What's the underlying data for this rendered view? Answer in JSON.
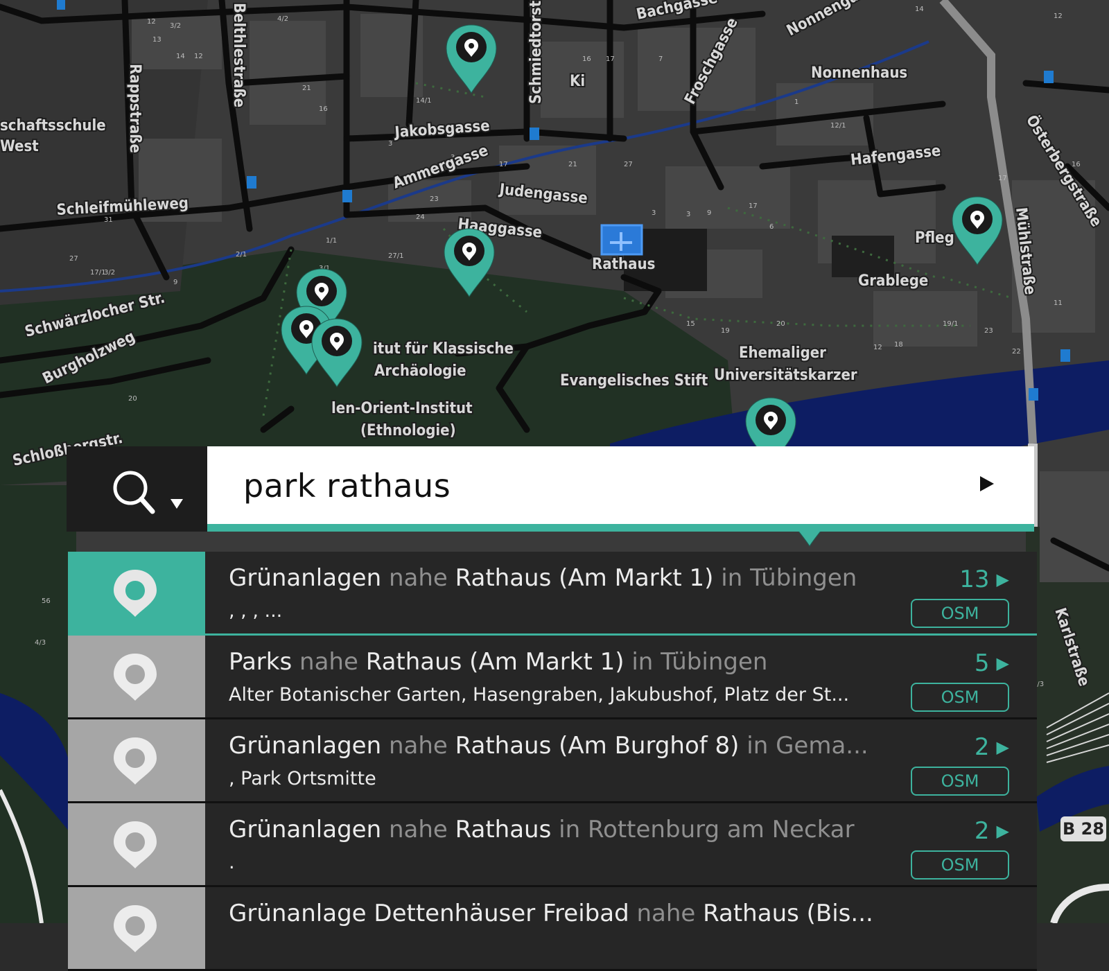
{
  "map": {
    "streets": [
      "Bachgasse",
      "Nonnengasse",
      "Nonnenhaus",
      "Froschgasse",
      "Schmiedtorstr.",
      "Belthlestraße",
      "Rappstraße",
      "Jakobsgasse",
      "Ammergasse",
      "Judengasse",
      "Haaggasse",
      "Hafengasse",
      "Österbergstraße",
      "Mühlstraße",
      "Schleifmühleweg",
      "Schwärzlocher Str.",
      "Burgholzweg",
      "Schloßbergstr.",
      "Karlstraße"
    ],
    "places": [
      "schaftsschule",
      "West",
      "Rathaus",
      "Pfleg",
      "Grablege",
      "Ehemaliger",
      "Universitätskarzer",
      "Evangelisches Stift",
      "itut für Klassische",
      "Archäologie",
      "len-Orient-Institut",
      "(Ethnologie)",
      "Ki",
      "B 28"
    ]
  },
  "search": {
    "query": "park rathaus",
    "colors": {
      "accent": "#3db39e",
      "panel": "#1d1d1d",
      "row": "#262626"
    }
  },
  "results": [
    {
      "category": "Grünanlagen",
      "near": "nahe",
      "place": "Rathaus (Am Markt 1)",
      "in": "in",
      "city": "Tübingen",
      "subtitle": ", , , ...",
      "count": "13",
      "source": "OSM",
      "active": true
    },
    {
      "category": "Parks",
      "near": "nahe",
      "place": "Rathaus (Am Markt 1)",
      "in": "in",
      "city": "Tübingen",
      "subtitle": "Alter Botanischer Garten, Hasengraben, Jakubushof, Platz der St...",
      "count": "5",
      "source": "OSM",
      "active": false
    },
    {
      "category": "Grünanlagen",
      "near": "nahe",
      "place": "Rathaus (Am Burghof 8)",
      "in": "in",
      "city": "Gema...",
      "subtitle": ", Park Ortsmitte",
      "count": "2",
      "source": "OSM",
      "active": false
    },
    {
      "category": "Grünanlagen",
      "near": "nahe",
      "place": "Rathaus",
      "in": "in",
      "city": "Rottenburg am Neckar",
      "subtitle": ".",
      "count": "2",
      "source": "OSM",
      "active": false
    },
    {
      "category": "Grünanlage Dettenhäuser Freibad",
      "near": "nahe",
      "place": "Rathaus (Bis...",
      "in": "",
      "city": "",
      "subtitle": "",
      "count": "",
      "source": "",
      "active": false
    }
  ]
}
